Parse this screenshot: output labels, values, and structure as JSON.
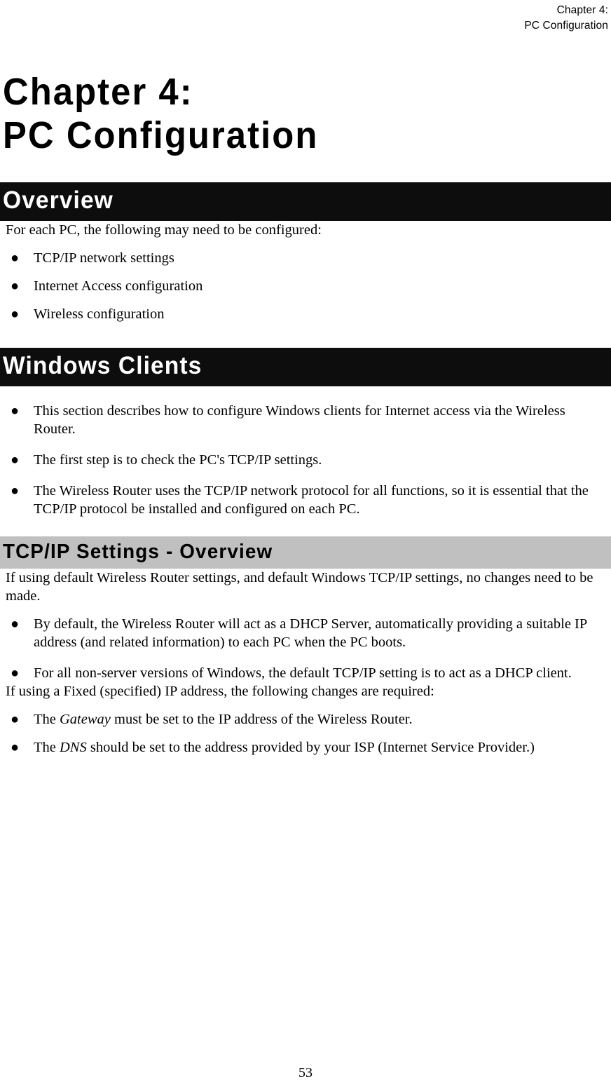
{
  "running_header": {
    "line1": "Chapter 4:",
    "line2": "PC Configuration"
  },
  "chapter_title": {
    "line1": "Chapter 4:",
    "line2": "PC Configuration"
  },
  "sections": {
    "overview": {
      "heading": "Overview",
      "intro": "For each PC, the following may need to be configured:",
      "bullets": [
        "TCP/IP network settings",
        "Internet Access configuration",
        "Wireless configuration"
      ]
    },
    "windows_clients": {
      "heading": "Windows Clients",
      "bullets": [
        "This section describes how to configure Windows clients for Internet access via the Wireless Router.",
        "The first step is to check the PC's TCP/IP settings.",
        "The Wireless Router uses the TCP/IP network protocol for all functions, so it is essential that the TCP/IP protocol be installed and configured on each PC."
      ]
    },
    "tcpip_settings": {
      "heading": "TCP/IP Settings - Overview",
      "intro": "If using default Wireless Router settings, and default Windows TCP/IP settings, no changes need to be made.",
      "bullets": [
        "By default, the Wireless Router will act as a DHCP Server, automatically providing a suitable IP address (and related information) to each PC when the PC boots.",
        "For all non-server versions of Windows, the default TCP/IP setting is to act as a DHCP client."
      ],
      "fixed_intro": "If using a Fixed (specified) IP address, the following changes are required:",
      "fixed_bullets": [
        {
          "prefix": "The ",
          "emphasis": "Gateway",
          "suffix": " must be set to the IP address of the Wireless Router."
        },
        {
          "prefix": "The ",
          "emphasis": "DNS",
          "suffix": " should be set to the address provided by your ISP (Internet Service Provider.)"
        }
      ]
    }
  },
  "bullet_glyph": "●",
  "footer": {
    "page_number": "53"
  },
  "colors": {
    "banner_dark_bg": "#0d0d0d",
    "banner_dark_text": "#ffffff",
    "banner_gray_bg": "#c0c0c0",
    "banner_gray_text": "#000000",
    "page_bg": "#ffffff",
    "text": "#000000"
  }
}
